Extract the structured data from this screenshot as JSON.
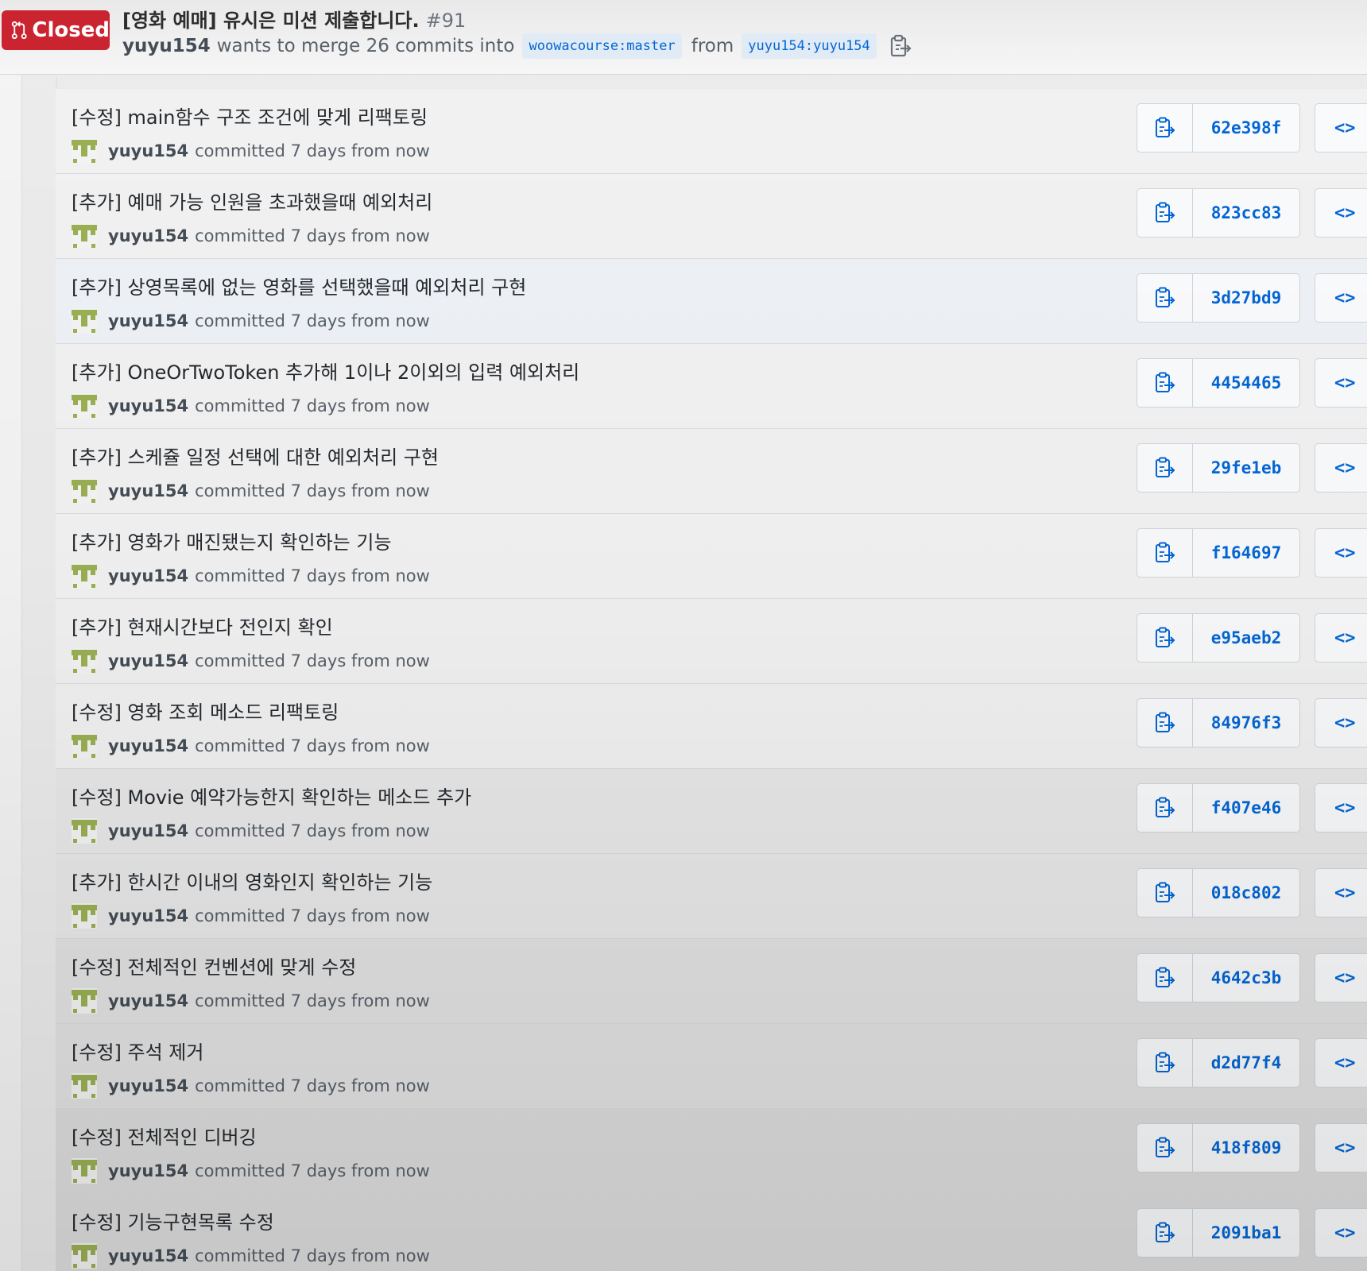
{
  "header": {
    "state": "Closed",
    "state_color": "#cb2431",
    "title": "[영화 예매] 유시은 미션 제출합니다.",
    "number": "#91",
    "author": "yuyu154",
    "merge_text": "wants to merge 26 commits into",
    "base_branch": "woowacourse:master",
    "from_text": "from",
    "head_branch": "yuyu154:yuyu154"
  },
  "commits": [
    {
      "message": "[수정] main함수 구조 조건에 맞게 리팩토링",
      "author": "yuyu154",
      "action": "committed",
      "time": "7 days from now",
      "sha": "62e398f"
    },
    {
      "message": "[추가] 예매 가능 인원을 초과했을때 예외처리",
      "author": "yuyu154",
      "action": "committed",
      "time": "7 days from now",
      "sha": "823cc83"
    },
    {
      "message": "[추가] 상영목록에 없는 영화를 선택했을때 예외처리 구현",
      "author": "yuyu154",
      "action": "committed",
      "time": "7 days from now",
      "sha": "3d27bd9"
    },
    {
      "message": "[추가] OneOrTwoToken 추가해 1이나 2이외의 입력 예외처리",
      "author": "yuyu154",
      "action": "committed",
      "time": "7 days from now",
      "sha": "4454465"
    },
    {
      "message": "[추가] 스케쥴 일정 선택에 대한 예외처리 구현",
      "author": "yuyu154",
      "action": "committed",
      "time": "7 days from now",
      "sha": "29fe1eb"
    },
    {
      "message": "[추가] 영화가 매진됐는지 확인하는 기능",
      "author": "yuyu154",
      "action": "committed",
      "time": "7 days from now",
      "sha": "f164697"
    },
    {
      "message": "[추가] 현재시간보다 전인지 확인",
      "author": "yuyu154",
      "action": "committed",
      "time": "7 days from now",
      "sha": "e95aeb2"
    },
    {
      "message": "[수정] 영화 조회 메소드 리팩토링",
      "author": "yuyu154",
      "action": "committed",
      "time": "7 days from now",
      "sha": "84976f3"
    },
    {
      "message": "[수정] Movie 예약가능한지 확인하는 메소드 추가",
      "author": "yuyu154",
      "action": "committed",
      "time": "7 days from now",
      "sha": "f407e46"
    },
    {
      "message": "[추가] 한시간 이내의 영화인지 확인하는 기능",
      "author": "yuyu154",
      "action": "committed",
      "time": "7 days from now",
      "sha": "018c802"
    },
    {
      "message": "[수정] 전체적인 컨벤션에 맞게 수정",
      "author": "yuyu154",
      "action": "committed",
      "time": "7 days from now",
      "sha": "4642c3b"
    },
    {
      "message": "[수정] 주석 제거",
      "author": "yuyu154",
      "action": "committed",
      "time": "7 days from now",
      "sha": "d2d77f4"
    },
    {
      "message": "[수정] 전체적인 디버깅",
      "author": "yuyu154",
      "action": "committed",
      "time": "7 days from now",
      "sha": "418f809"
    },
    {
      "message": "[수정] 기능구현목록 수정",
      "author": "yuyu154",
      "action": "committed",
      "time": "7 days from now",
      "sha": "2091ba1"
    }
  ],
  "browse_label": "<>",
  "icons": {
    "state": "git-pull-request-icon",
    "copy": "clippy-icon",
    "browse": "code-icon",
    "avatar": "identicon-avatar"
  },
  "colors": {
    "link": "#0366d6",
    "closed": "#cb2431",
    "avatar": "#9bb054"
  }
}
